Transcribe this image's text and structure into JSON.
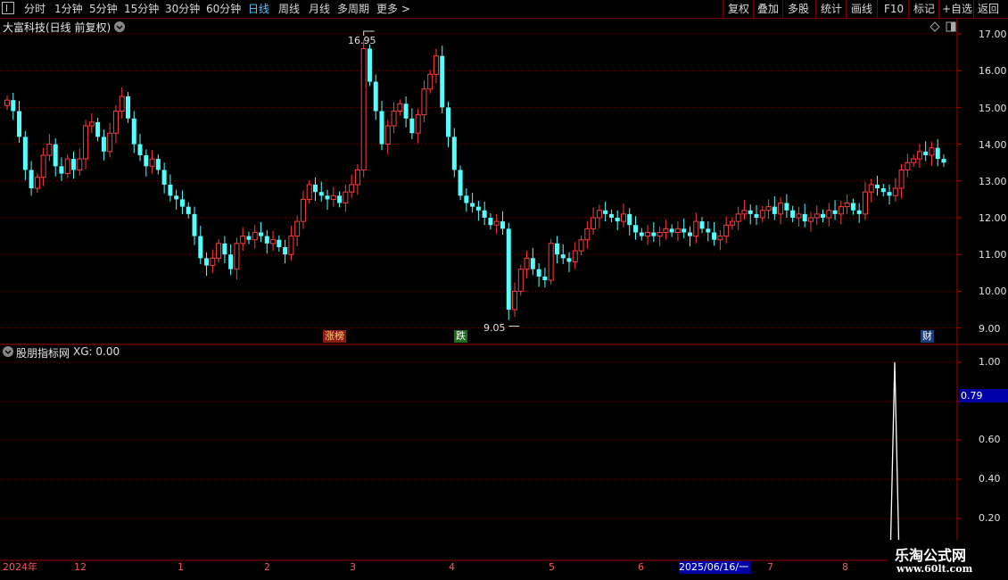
{
  "toolbar": {
    "periods": [
      "分时",
      "1分钟",
      "5分钟",
      "15分钟",
      "30分钟",
      "60分钟",
      "日线",
      "周线",
      "月线",
      "多周期",
      "更多 >"
    ],
    "active_period": "日线",
    "right_buttons": [
      "复权",
      "叠加",
      "多股",
      "统计",
      "画线",
      "F10",
      "标记",
      "+自选",
      "返回"
    ]
  },
  "price_panel": {
    "title": "大富科技(日线 前复权)",
    "max_label": "16.95",
    "min_label": "9.05",
    "badges": [
      "涨榜",
      "跌",
      "财"
    ],
    "y_ticks": [
      "17.00",
      "16.00",
      "15.00",
      "14.00",
      "13.00",
      "12.00",
      "11.00",
      "10.00",
      "9.00"
    ]
  },
  "indicator_panel": {
    "title": "股朋指标网",
    "value_text": "XG: 0.00",
    "y_ticks": [
      "1.00",
      "0.60",
      "0.40",
      "0.20"
    ],
    "cursor_value": "0.79"
  },
  "date_axis": {
    "labels": [
      "2024年",
      "12",
      "1",
      "2",
      "3",
      "4",
      "5",
      "6",
      "7",
      "8"
    ],
    "cursor_date": "2025/06/16/一"
  },
  "watermark": {
    "title": "乐淘公式网",
    "url": "www.60lt.com"
  },
  "colors": {
    "up": "#ff3c3c",
    "down": "#54ffff",
    "grid": "#7a0000",
    "bg": "#000000",
    "accent": "#4fc9ff",
    "cursor_bg": "#0000a8"
  },
  "chart_data": {
    "type": "candlestick",
    "title": "大富科技(日线 前复权)",
    "ylim": [
      8.7,
      17.4
    ],
    "y_ticks": [
      9,
      10,
      11,
      12,
      13,
      14,
      15,
      16,
      17
    ],
    "marked_high": 16.95,
    "marked_low": 9.05,
    "close": [
      15.2,
      14.9,
      14.2,
      13.3,
      12.8,
      13.1,
      13.7,
      14.0,
      13.4,
      13.2,
      13.6,
      13.3,
      13.6,
      14.5,
      14.6,
      14.2,
      13.8,
      14.3,
      14.9,
      15.3,
      14.7,
      14.0,
      13.7,
      13.4,
      13.6,
      13.3,
      12.9,
      12.6,
      12.5,
      12.3,
      12.1,
      11.5,
      10.9,
      10.7,
      10.9,
      11.3,
      11.0,
      10.6,
      11.3,
      11.5,
      11.4,
      11.6,
      11.5,
      11.3,
      11.4,
      11.2,
      11.0,
      11.5,
      11.9,
      12.5,
      12.9,
      12.7,
      12.6,
      12.5,
      12.6,
      12.4,
      12.7,
      12.9,
      13.3,
      16.6,
      15.7,
      14.9,
      14.0,
      14.5,
      14.9,
      15.1,
      14.7,
      14.3,
      14.8,
      15.5,
      15.9,
      16.4,
      15.0,
      14.2,
      13.3,
      12.6,
      12.4,
      12.3,
      12.2,
      12.0,
      11.8,
      11.9,
      11.7,
      9.5,
      10.0,
      10.6,
      10.9,
      10.6,
      10.4,
      10.3,
      11.3,
      11.0,
      10.9,
      10.8,
      11.1,
      11.4,
      11.7,
      12.0,
      12.2,
      12.1,
      12.0,
      11.9,
      12.1,
      11.8,
      11.6,
      11.5,
      11.6,
      11.5,
      11.6,
      11.7,
      11.6,
      11.7,
      11.6,
      11.5,
      11.9,
      11.7,
      11.6,
      11.4,
      11.5,
      11.8,
      11.9,
      12.1,
      12.2,
      12.1,
      12.0,
      12.2,
      12.3,
      12.1,
      12.4,
      12.2,
      12.0,
      12.1,
      11.9,
      12.0,
      12.1,
      12.0,
      12.2,
      12.1,
      12.3,
      12.4,
      12.2,
      12.1,
      12.7,
      12.9,
      12.8,
      12.7,
      12.6,
      12.8,
      13.3,
      13.5,
      13.6,
      13.8,
      13.7,
      13.9,
      13.6,
      13.5
    ]
  }
}
